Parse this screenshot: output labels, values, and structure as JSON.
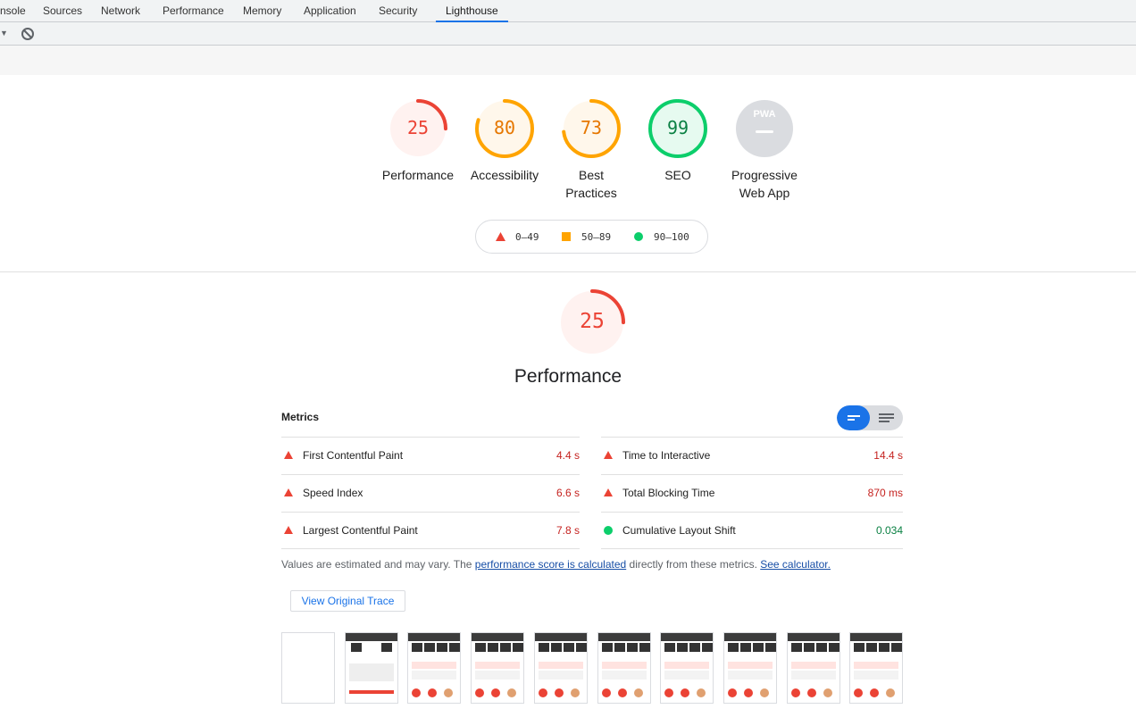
{
  "devtools": {
    "tabs": [
      {
        "label": "nsole"
      },
      {
        "label": "Sources"
      },
      {
        "label": "Network"
      },
      {
        "label": "Performance"
      },
      {
        "label": "Memory"
      },
      {
        "label": "Application"
      },
      {
        "label": "Security"
      },
      {
        "label": "Lighthouse",
        "active": true
      }
    ]
  },
  "colors": {
    "fail": "#eb4335",
    "average": "#ffa400",
    "pass": "#0cce6b",
    "accent": "#1a73e8"
  },
  "categories": [
    {
      "label": "Performance",
      "score": "25",
      "fraction": 0.25,
      "rating": "fail"
    },
    {
      "label": "Accessibility",
      "score": "80",
      "fraction": 0.8,
      "rating": "average"
    },
    {
      "label_line1": "Best",
      "label_line2": "Practices",
      "score": "73",
      "fraction": 0.73,
      "rating": "average"
    },
    {
      "label": "SEO",
      "score": "99",
      "fraction": 0.99,
      "rating": "pass"
    },
    {
      "label_line1": "Progressive",
      "label_line2": "Web App",
      "badge": "PWA",
      "rating": "na"
    }
  ],
  "legend": {
    "fail": "0–49",
    "average": "50–89",
    "pass": "90–100"
  },
  "performance_section": {
    "score": "25",
    "fraction": 0.25,
    "title": "Performance"
  },
  "metrics": {
    "heading": "Metrics",
    "left": [
      {
        "name": "First Contentful Paint",
        "value": "4.4 s",
        "rating": "fail"
      },
      {
        "name": "Speed Index",
        "value": "6.6 s",
        "rating": "fail"
      },
      {
        "name": "Largest Contentful Paint",
        "value": "7.8 s",
        "rating": "fail"
      }
    ],
    "right": [
      {
        "name": "Time to Interactive",
        "value": "14.4 s",
        "rating": "fail"
      },
      {
        "name": "Total Blocking Time",
        "value": "870 ms",
        "rating": "fail"
      },
      {
        "name": "Cumulative Layout Shift",
        "value": "0.034",
        "rating": "pass"
      }
    ]
  },
  "note": {
    "prefix": "Values are estimated and may vary. The ",
    "link1": "performance score is calculated",
    "middle": " directly from these metrics. ",
    "link2": "See calculator."
  },
  "trace_button": "View Original Trace",
  "filmstrip_count": 10
}
